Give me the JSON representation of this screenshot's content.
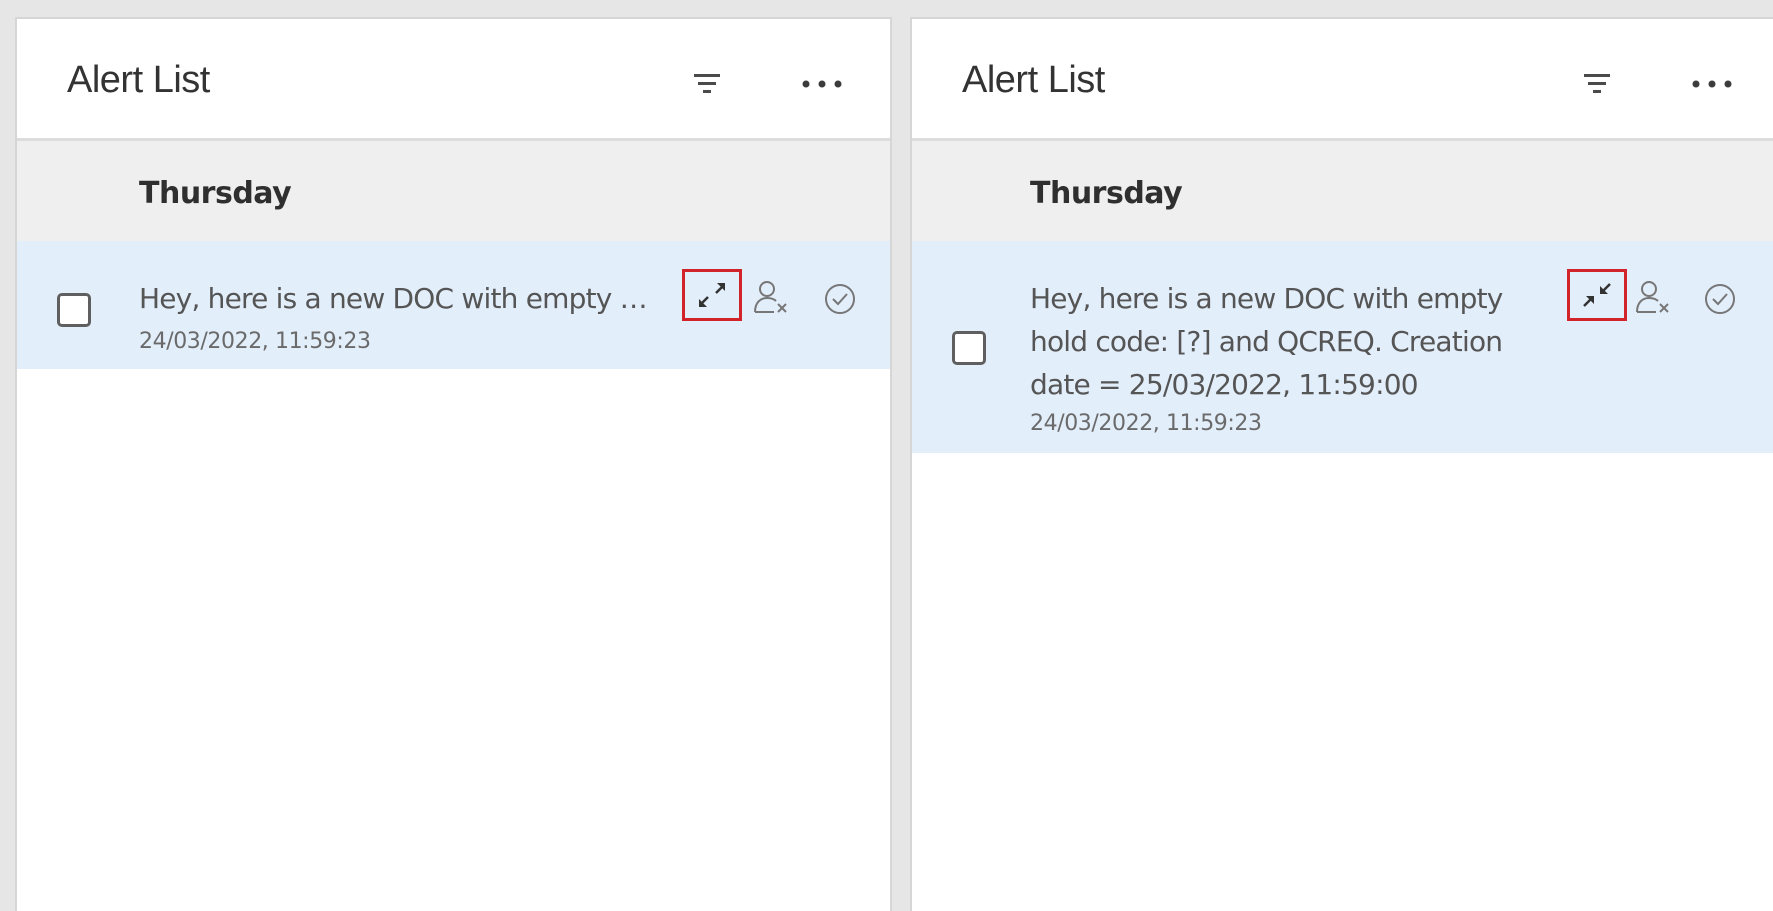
{
  "panels": [
    {
      "title": "Alert List",
      "group_label": "Thursday",
      "alert": {
        "text": "Hey, here is a new DOC with empty hold code: [?] and QCREQ. Creation date = 25/03/2022, 11:59:00",
        "timestamp": "24/03/2022, 11:59:23",
        "expanded": false
      },
      "icons": {
        "filter": "filter-icon",
        "more": "more-horizontal-icon",
        "expand": "expand-icon",
        "unassign": "user-remove-icon",
        "acknowledge": "check-circle-icon"
      }
    },
    {
      "title": "Alert List",
      "group_label": "Thursday",
      "alert": {
        "text": "Hey, here is a new DOC with empty hold code: [?] and QCREQ. Creation date = 25/03/2022, 11:59:00",
        "timestamp": "24/03/2022, 11:59:23",
        "expanded": true
      },
      "icons": {
        "filter": "filter-icon",
        "more": "more-horizontal-icon",
        "collapse": "collapse-icon",
        "unassign": "user-remove-icon",
        "acknowledge": "check-circle-icon"
      }
    }
  ],
  "colors": {
    "selected_row_bg": "#e3eefb",
    "group_header_bg": "#efefef",
    "highlight_border": "#d2232a",
    "title_text": "#333333"
  }
}
